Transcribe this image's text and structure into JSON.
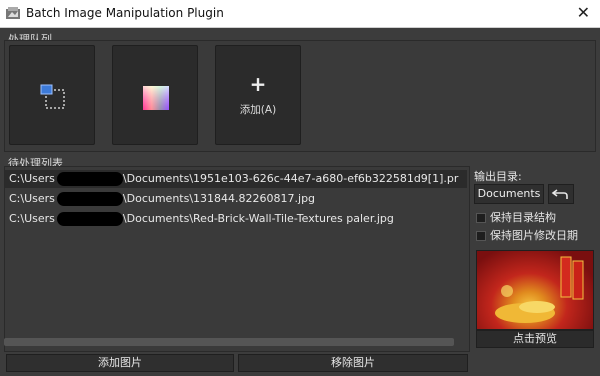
{
  "window": {
    "title": "Batch Image Manipulation Plugin",
    "close_glyph": "✕"
  },
  "queue": {
    "label": "处理队列",
    "add_label": "添加(A)",
    "buttons": [
      {
        "icon": "crop-icon"
      },
      {
        "icon": "color-icon"
      },
      {
        "icon": "add-icon"
      }
    ]
  },
  "file_list": {
    "label": "待处理列表",
    "items": [
      {
        "prefix": "C:\\Users",
        "suffix": "\\Documents\\1951e103-626c-44e7-a680-ef6b322581d9[1].pr"
      },
      {
        "prefix": "C:\\Users",
        "suffix": "\\Documents\\131844.82260817.jpg"
      },
      {
        "prefix": "C:\\Users",
        "suffix": "\\Documents\\Red-Brick-Wall-Tile-Textures paler.jpg"
      }
    ],
    "add_button": "添加图片",
    "remove_button": "移除图片"
  },
  "output": {
    "label": "输出目录:",
    "directory": "Documents",
    "undo_icon": "undo-icon",
    "keep_structure": "保持目录结构",
    "keep_dates": "保持图片修改日期",
    "preview_label": "点击预览"
  }
}
